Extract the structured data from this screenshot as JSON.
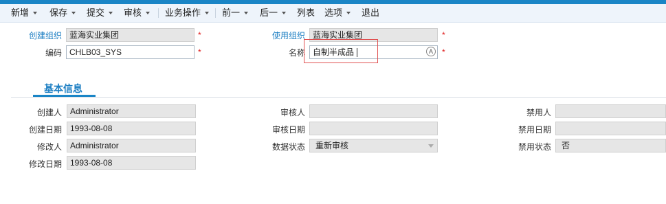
{
  "toolbar": {
    "items": [
      {
        "label": "新增"
      },
      {
        "label": "保存"
      },
      {
        "label": "提交"
      },
      {
        "label": "审核"
      },
      {
        "label": "业务操作"
      },
      {
        "label": "前一"
      },
      {
        "label": "后一"
      },
      {
        "label": "列表"
      },
      {
        "label": "选项"
      },
      {
        "label": "退出"
      }
    ]
  },
  "header": {
    "create_org": {
      "label": "创建组织",
      "value": "蓝海实业集团"
    },
    "use_org": {
      "label": "使用组织",
      "value": "蓝海实业集团"
    },
    "code": {
      "label": "编码",
      "value": "CHLB03_SYS"
    },
    "name": {
      "label": "名称",
      "value": "自制半成品"
    },
    "required_mark": "*"
  },
  "section": {
    "title": "基本信息"
  },
  "basic_info": {
    "creator": {
      "label": "创建人",
      "value": "Administrator"
    },
    "create_date": {
      "label": "创建日期",
      "value": "1993-08-08"
    },
    "modifier": {
      "label": "修改人",
      "value": "Administrator"
    },
    "modify_date": {
      "label": "修改日期",
      "value": "1993-08-08"
    },
    "approver": {
      "label": "审核人",
      "value": ""
    },
    "approve_date": {
      "label": "审核日期",
      "value": ""
    },
    "data_status": {
      "label": "数据状态",
      "value": "重新审核"
    },
    "disabler": {
      "label": "禁用人",
      "value": ""
    },
    "disable_date": {
      "label": "禁用日期",
      "value": ""
    },
    "disable_status": {
      "label": "禁用状态",
      "value": "否"
    }
  },
  "colors": {
    "accent": "#1a85c6",
    "label_blue": "#1a7dc2",
    "required": "#e02020",
    "highlight": "#e05050"
  }
}
